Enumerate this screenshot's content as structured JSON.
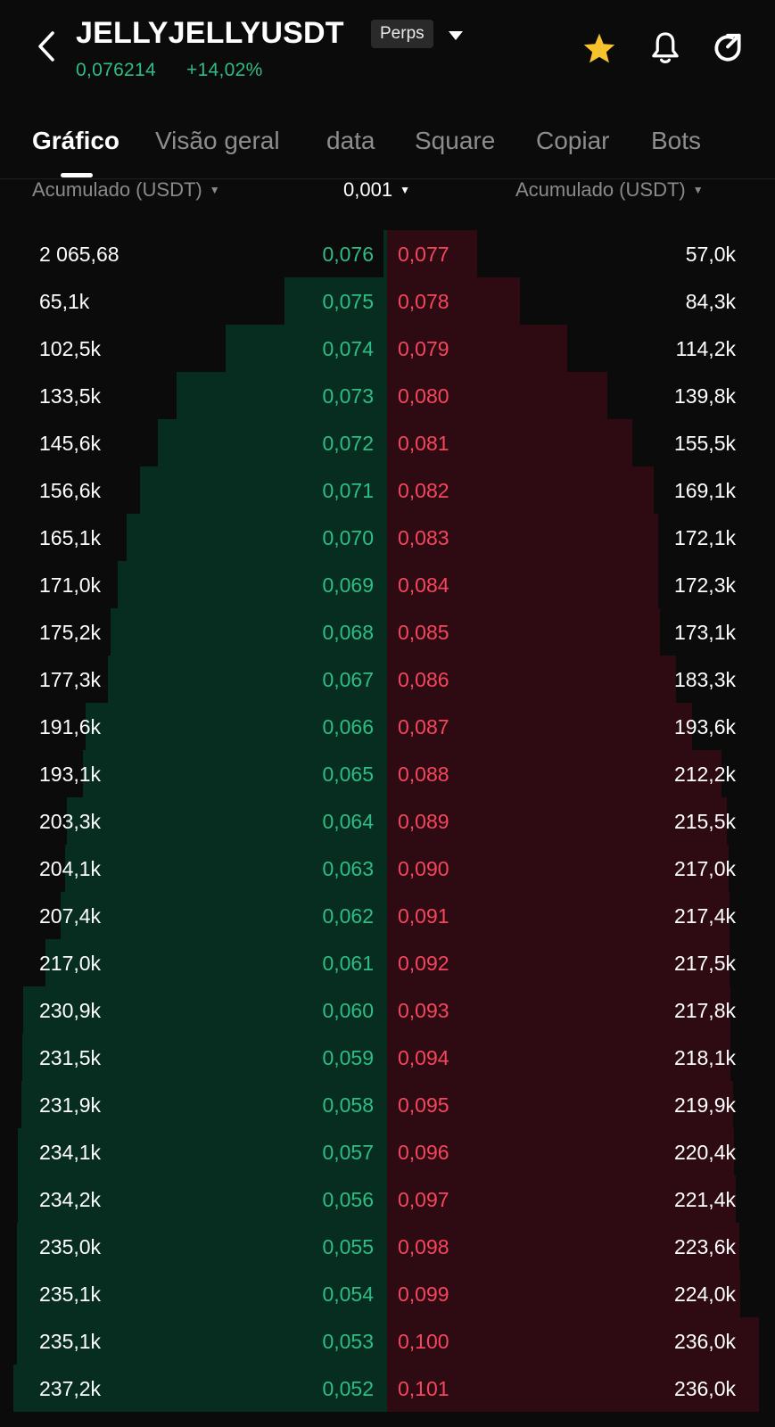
{
  "header": {
    "symbol": "JELLYJELLYUSDT",
    "badge": "Perps",
    "price": "0,076214",
    "change": "+14,02%",
    "icons": {
      "back": "back-arrow-icon",
      "caret": "caret-down-icon",
      "star": "star-icon",
      "bell": "bell-icon",
      "share": "share-icon"
    },
    "favorited": true
  },
  "tabs": [
    "Gráfico",
    "Visão geral",
    "data",
    "Square",
    "Copiar",
    "Bots"
  ],
  "active_tab": "Gráfico",
  "columns": {
    "left": "Acumulado (USDT)",
    "precision": "0,001",
    "right": "Acumulado (USDT)"
  },
  "colors": {
    "bid": "#2ebd85",
    "ask": "#f6465d",
    "bid_bg": "#062d20",
    "ask_bg": "#2e0b12",
    "star": "#f7c22b"
  },
  "depth_scale": {
    "max_cumulative": 240000
  },
  "rows": [
    {
      "bid_total": "2 065,68",
      "bid_price": "0,076",
      "ask_price": "0,077",
      "ask_total": "57,0k",
      "bid_value": 2065.68,
      "ask_value": 57000
    },
    {
      "bid_total": "65,1k",
      "bid_price": "0,075",
      "ask_price": "0,078",
      "ask_total": "84,3k",
      "bid_value": 65100,
      "ask_value": 84300
    },
    {
      "bid_total": "102,5k",
      "bid_price": "0,074",
      "ask_price": "0,079",
      "ask_total": "114,2k",
      "bid_value": 102500,
      "ask_value": 114200
    },
    {
      "bid_total": "133,5k",
      "bid_price": "0,073",
      "ask_price": "0,080",
      "ask_total": "139,8k",
      "bid_value": 133500,
      "ask_value": 139800
    },
    {
      "bid_total": "145,6k",
      "bid_price": "0,072",
      "ask_price": "0,081",
      "ask_total": "155,5k",
      "bid_value": 145600,
      "ask_value": 155500
    },
    {
      "bid_total": "156,6k",
      "bid_price": "0,071",
      "ask_price": "0,082",
      "ask_total": "169,1k",
      "bid_value": 156600,
      "ask_value": 169100
    },
    {
      "bid_total": "165,1k",
      "bid_price": "0,070",
      "ask_price": "0,083",
      "ask_total": "172,1k",
      "bid_value": 165100,
      "ask_value": 172100
    },
    {
      "bid_total": "171,0k",
      "bid_price": "0,069",
      "ask_price": "0,084",
      "ask_total": "172,3k",
      "bid_value": 171000,
      "ask_value": 172300
    },
    {
      "bid_total": "175,2k",
      "bid_price": "0,068",
      "ask_price": "0,085",
      "ask_total": "173,1k",
      "bid_value": 175200,
      "ask_value": 173100
    },
    {
      "bid_total": "177,3k",
      "bid_price": "0,067",
      "ask_price": "0,086",
      "ask_total": "183,3k",
      "bid_value": 177300,
      "ask_value": 183300
    },
    {
      "bid_total": "191,6k",
      "bid_price": "0,066",
      "ask_price": "0,087",
      "ask_total": "193,6k",
      "bid_value": 191600,
      "ask_value": 193600
    },
    {
      "bid_total": "193,1k",
      "bid_price": "0,065",
      "ask_price": "0,088",
      "ask_total": "212,2k",
      "bid_value": 193100,
      "ask_value": 212200
    },
    {
      "bid_total": "203,3k",
      "bid_price": "0,064",
      "ask_price": "0,089",
      "ask_total": "215,5k",
      "bid_value": 203300,
      "ask_value": 215500
    },
    {
      "bid_total": "204,1k",
      "bid_price": "0,063",
      "ask_price": "0,090",
      "ask_total": "217,0k",
      "bid_value": 204100,
      "ask_value": 217000
    },
    {
      "bid_total": "207,4k",
      "bid_price": "0,062",
      "ask_price": "0,091",
      "ask_total": "217,4k",
      "bid_value": 207400,
      "ask_value": 217400
    },
    {
      "bid_total": "217,0k",
      "bid_price": "0,061",
      "ask_price": "0,092",
      "ask_total": "217,5k",
      "bid_value": 217000,
      "ask_value": 217500
    },
    {
      "bid_total": "230,9k",
      "bid_price": "0,060",
      "ask_price": "0,093",
      "ask_total": "217,8k",
      "bid_value": 230900,
      "ask_value": 217800
    },
    {
      "bid_total": "231,5k",
      "bid_price": "0,059",
      "ask_price": "0,094",
      "ask_total": "218,1k",
      "bid_value": 231500,
      "ask_value": 218100
    },
    {
      "bid_total": "231,9k",
      "bid_price": "0,058",
      "ask_price": "0,095",
      "ask_total": "219,9k",
      "bid_value": 231900,
      "ask_value": 219900
    },
    {
      "bid_total": "234,1k",
      "bid_price": "0,057",
      "ask_price": "0,096",
      "ask_total": "220,4k",
      "bid_value": 234100,
      "ask_value": 220400
    },
    {
      "bid_total": "234,2k",
      "bid_price": "0,056",
      "ask_price": "0,097",
      "ask_total": "221,4k",
      "bid_value": 234200,
      "ask_value": 221400
    },
    {
      "bid_total": "235,0k",
      "bid_price": "0,055",
      "ask_price": "0,098",
      "ask_total": "223,6k",
      "bid_value": 235000,
      "ask_value": 223600
    },
    {
      "bid_total": "235,1k",
      "bid_price": "0,054",
      "ask_price": "0,099",
      "ask_total": "224,0k",
      "bid_value": 235100,
      "ask_value": 224000
    },
    {
      "bid_total": "235,1k",
      "bid_price": "0,053",
      "ask_price": "0,100",
      "ask_total": "236,0k",
      "bid_value": 235100,
      "ask_value": 236000
    },
    {
      "bid_total": "237,2k",
      "bid_price": "0,052",
      "ask_price": "0,101",
      "ask_total": "236,0k",
      "bid_value": 237200,
      "ask_value": 236000
    }
  ]
}
